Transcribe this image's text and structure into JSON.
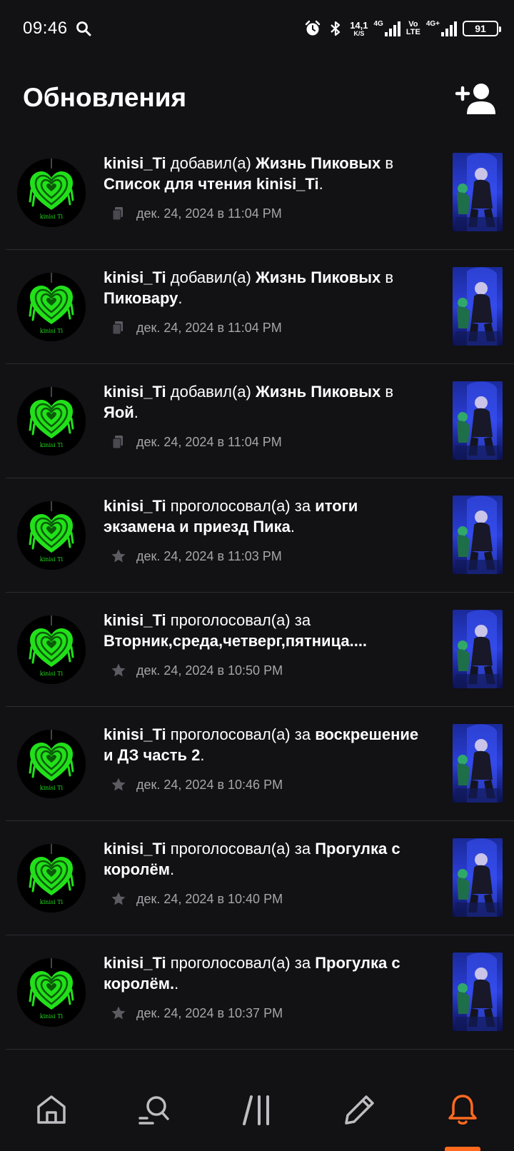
{
  "status_bar": {
    "time": "09:46",
    "net_speed_value": "14,1",
    "net_speed_unit": "K/S",
    "network_1": "4G",
    "volte_top": "Vo",
    "volte_bottom": "LTE",
    "network_2": "4G+",
    "battery": "91"
  },
  "header": {
    "title": "Обновления"
  },
  "colors": {
    "background": "#121114",
    "accent": "#ff6a1f",
    "meta_text": "#a6a5aa"
  },
  "feed": [
    {
      "user": "kinisi_Ti",
      "action": " добавил(а) ",
      "target": "Жизнь Пиковых",
      "middle": " в ",
      "target2": "Список для чтения kinisi_Ti",
      "tail": ".",
      "icon": "reading-list-icon",
      "timestamp": "дек. 24, 2024 в 11:04 PM"
    },
    {
      "user": "kinisi_Ti",
      "action": " добавил(а) ",
      "target": "Жизнь Пиковых",
      "middle": " в ",
      "target2": "Пиковару",
      "tail": ".",
      "icon": "reading-list-icon",
      "timestamp": "дек. 24, 2024 в 11:04 PM"
    },
    {
      "user": "kinisi_Ti",
      "action": " добавил(а) ",
      "target": "Жизнь Пиковых",
      "middle": " в ",
      "target2": "Яой",
      "tail": ".",
      "icon": "reading-list-icon",
      "timestamp": "дек. 24, 2024 в 11:04 PM"
    },
    {
      "user": "kinisi_Ti",
      "action": " проголосовал(а) за ",
      "target": "итоги экзамена и приезд Пика",
      "middle": "",
      "target2": "",
      "tail": ".",
      "icon": "star-icon",
      "timestamp": "дек. 24, 2024 в 11:03 PM"
    },
    {
      "user": "kinisi_Ti",
      "action": " проголосовал(а) за ",
      "target": "Вторник,среда,четверг,пятница....",
      "middle": "",
      "target2": "",
      "tail": "",
      "icon": "star-icon",
      "timestamp": "дек. 24, 2024 в 10:50 PM"
    },
    {
      "user": "kinisi_Ti",
      "action": " проголосовал(а) за ",
      "target": "воскрешение и ДЗ часть 2",
      "middle": "",
      "target2": "",
      "tail": ".",
      "icon": "star-icon",
      "timestamp": "дек. 24, 2024 в 10:46 PM"
    },
    {
      "user": "kinisi_Ti",
      "action": " проголосовал(а) за ",
      "target": "Прогулка с королём",
      "middle": "",
      "target2": "",
      "tail": ".",
      "icon": "star-icon",
      "timestamp": "дек. 24, 2024 в 10:40 PM"
    },
    {
      "user": "kinisi_Ti",
      "action": " проголосовал(а) за ",
      "target": "Прогулка с королём.",
      "middle": "",
      "target2": "",
      "tail": ".",
      "icon": "star-icon",
      "timestamp": "дек. 24, 2024 в 10:37 PM"
    }
  ],
  "bottom_nav": [
    {
      "name": "home",
      "icon": "home-icon",
      "active": false
    },
    {
      "name": "search",
      "icon": "search-icon",
      "active": false
    },
    {
      "name": "library",
      "icon": "library-icon",
      "active": false
    },
    {
      "name": "write",
      "icon": "pencil-icon",
      "active": false
    },
    {
      "name": "notifications",
      "icon": "bell-icon",
      "active": true
    }
  ]
}
